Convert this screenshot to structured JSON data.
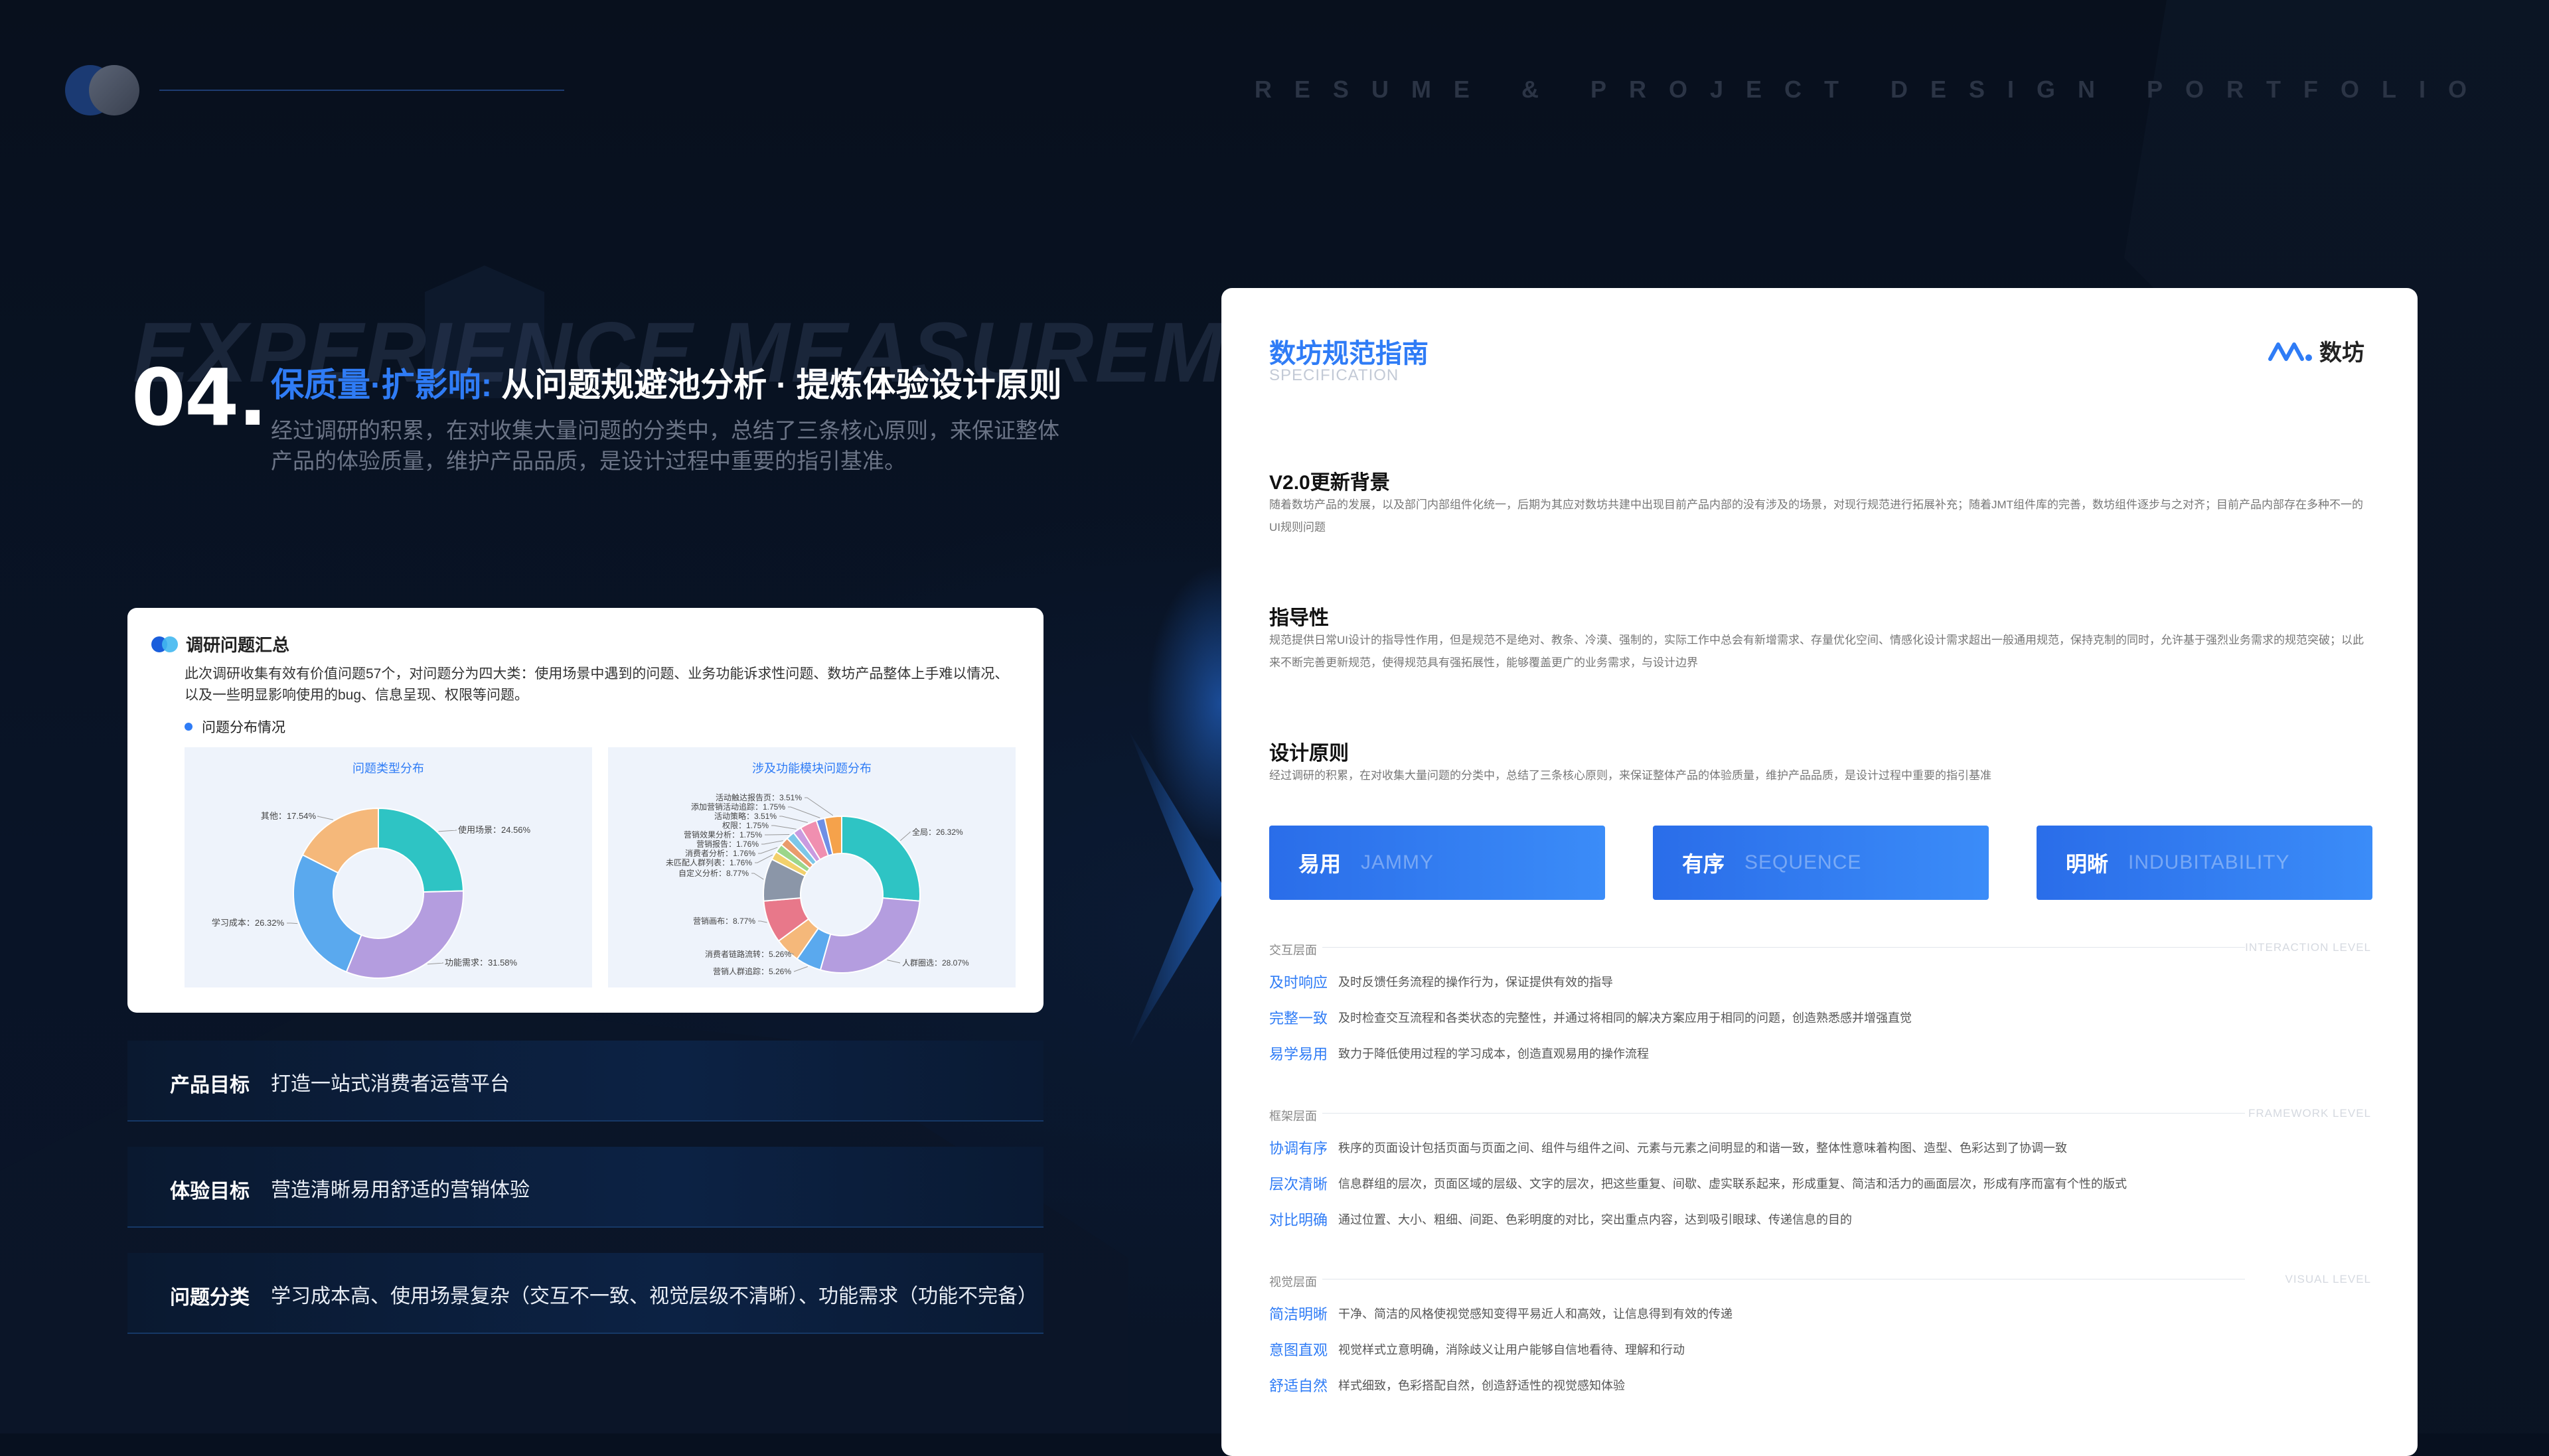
{
  "header": {
    "portfolio_label": "RESUME & PROJECT DESIGN PORTFOLIO"
  },
  "section": {
    "bg_word": "EXPERIENCE MEASUREMENT",
    "number": "04.",
    "title_highlight": "保质量·扩影响:",
    "title_main": "从问题规避池分析 · 提炼体验设计原则",
    "description": "经过调研的积累，在对收集大量问题的分类中，总结了三条核心原则，来保证整体产品的体验质量，维护产品品质，是设计过程中重要的指引基准。"
  },
  "survey": {
    "heading": "调研问题汇总",
    "text": "此次调研收集有效有价值问题57个，对问题分为四大类：使用场景中遇到的问题、业务功能诉求性问题、数坊产品整体上手难以情况、以及一些明显影响使用的bug、信息呈现、权限等问题。",
    "subheading": "问题分布情况"
  },
  "chart_data": [
    {
      "type": "pie",
      "title": "问题类型分布",
      "labels": [
        "使用场景",
        "功能需求",
        "学习成本",
        "其他"
      ],
      "values": [
        24.56,
        31.58,
        26.32,
        17.54
      ],
      "display": [
        "使用场景：24.56%",
        "功能需求：31.58%",
        "学习成本：26.32%",
        "其他：17.54%"
      ],
      "colors": [
        "#2ec4c4",
        "#b49ddf",
        "#5aa9ee",
        "#f5b87a"
      ]
    },
    {
      "type": "pie",
      "title": "涉及功能模块问题分布",
      "labels": [
        "全局",
        "人群圈选",
        "营销人群追踪",
        "消费者链路流转",
        "营销画布",
        "自定义分析",
        "未匹配人群列表",
        "消费者分析",
        "营销报告",
        "营销效果分析",
        "权限",
        "活动策略",
        "添加营销活动追踪",
        "活动触达报告页"
      ],
      "values": [
        26.32,
        28.07,
        5.26,
        5.26,
        8.77,
        8.77,
        1.76,
        1.76,
        1.76,
        1.75,
        1.75,
        3.51,
        1.75,
        3.51
      ],
      "display": [
        "全局：26.32%",
        "人群圈选：28.07%",
        "营销人群追踪：5.26%",
        "消费者链路流转：5.26%",
        "营销画布：8.77%",
        "自定义分析：8.77%",
        "未匹配人群列表：1.76%",
        "消费者分析：1.76%",
        "营销报告：1.76%",
        "营销效果分析：1.75%",
        "权限：1.75%",
        "活动策略：3.51%",
        "添加营销活动追踪：1.75%",
        "活动触达报告页：3.51%"
      ],
      "colors": [
        "#2ec4c4",
        "#b49ddf",
        "#5aa9ee",
        "#f5b87a",
        "#e8788a",
        "#8b96a8",
        "#f2d06b",
        "#9bd68a",
        "#e99b6c",
        "#7dc7e8",
        "#c99be0",
        "#f08fb0",
        "#6f8fe6",
        "#f5a24b"
      ]
    }
  ],
  "goals": [
    {
      "label": "产品目标",
      "value": "打造一站式消费者运营平台"
    },
    {
      "label": "体验目标",
      "value": "营造清晰易用舒适的营销体验"
    },
    {
      "label": "问题分类",
      "value": "学习成本高、使用场景复杂（交互不一致、视觉层级不清晰）、功能需求（功能不完备）"
    }
  ],
  "spec": {
    "title": "数坊规范指南",
    "subtitle": "SPECIFICATION",
    "brand": "数坊",
    "sections": [
      {
        "heading": "V2.0更新背景",
        "text": "随着数坊产品的发展，以及部门内部组件化统一，后期为其应对数坊共建中出现目前产品内部的没有涉及的场景，对现行规范进行拓展补充；随着JMT组件库的完善，数坊组件逐步与之对齐；目前产品内部存在多种不一的UI规则问题"
      },
      {
        "heading": "指导性",
        "text": "规范提供日常UI设计的指导性作用，但是规范不是绝对、教条、冷漠、强制的，实际工作中总会有新增需求、存量优化空间、情感化设计需求超出一般通用规范，保持克制的同时，允许基于强烈业务需求的规范突破；以此来不断完善更新规范，使得规范具有强拓展性，能够覆盖更广的业务需求，与设计边界"
      },
      {
        "heading": "设计原则",
        "text": "经过调研的积累，在对收集大量问题的分类中，总结了三条核心原则，来保证整体产品的体验质量，维护产品品质，是设计过程中重要的指引基准"
      }
    ],
    "principles": [
      {
        "cn": "易用",
        "en": "JAMMY"
      },
      {
        "cn": "有序",
        "en": "SEQUENCE"
      },
      {
        "cn": "明晰",
        "en": "INDUBITABILITY"
      }
    ],
    "levels": [
      {
        "name": "交互层面",
        "en": "INTERACTION LEVEL",
        "items": [
          {
            "k": "及时响应",
            "v": "及时反馈任务流程的操作行为，保证提供有效的指导"
          },
          {
            "k": "完整一致",
            "v": "及时检查交互流程和各类状态的完整性，并通过将相同的解决方案应用于相同的问题，创造熟悉感并增强直觉"
          },
          {
            "k": "易学易用",
            "v": "致力于降低使用过程的学习成本，创造直观易用的操作流程"
          }
        ]
      },
      {
        "name": "框架层面",
        "en": "FRAMEWORK LEVEL",
        "items": [
          {
            "k": "协调有序",
            "v": "秩序的页面设计包括页面与页面之间、组件与组件之间、元素与元素之间明显的和谐一致，整体性意味着构图、造型、色彩达到了协调一致"
          },
          {
            "k": "层次清晰",
            "v": "信息群组的层次，页面区域的层级、文字的层次，把这些重复、间歇、虚实联系起来，形成重复、简洁和活力的画面层次，形成有序而富有个性的版式"
          },
          {
            "k": "对比明确",
            "v": "通过位置、大小、粗细、间距、色彩明度的对比，突出重点内容，达到吸引眼球、传递信息的目的"
          }
        ]
      },
      {
        "name": "视觉层面",
        "en": "VISUAL LEVEL",
        "items": [
          {
            "k": "简洁明晰",
            "v": "干净、简洁的风格使视觉感知变得平易近人和高效，让信息得到有效的传递"
          },
          {
            "k": "意图直观",
            "v": "视觉样式立意明确，消除歧义让用户能够自信地看待、理解和行动"
          },
          {
            "k": "舒适自然",
            "v": "样式细致，色彩搭配自然，创造舒适性的视觉感知体验"
          }
        ]
      }
    ]
  }
}
